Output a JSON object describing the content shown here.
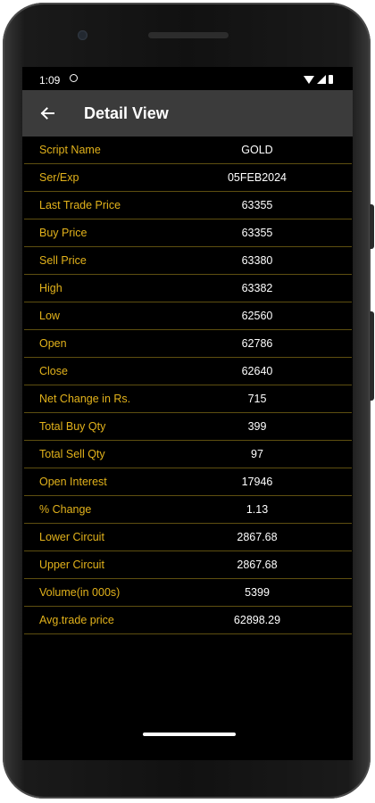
{
  "status": {
    "time": "1:09"
  },
  "toolbar": {
    "title": "Detail View"
  },
  "details": [
    {
      "label": "Script Name",
      "value": "GOLD"
    },
    {
      "label": "Ser/Exp",
      "value": "05FEB2024"
    },
    {
      "label": "Last Trade Price",
      "value": "63355"
    },
    {
      "label": "Buy Price",
      "value": "63355"
    },
    {
      "label": "Sell Price",
      "value": "63380"
    },
    {
      "label": "High",
      "value": "63382"
    },
    {
      "label": "Low",
      "value": "62560"
    },
    {
      "label": "Open",
      "value": "62786"
    },
    {
      "label": "Close",
      "value": "62640"
    },
    {
      "label": "Net Change in Rs.",
      "value": "715"
    },
    {
      "label": "Total Buy Qty",
      "value": "399"
    },
    {
      "label": "Total Sell Qty",
      "value": "97"
    },
    {
      "label": "Open Interest",
      "value": "17946"
    },
    {
      "label": "% Change",
      "value": "1.13"
    },
    {
      "label": "Lower Circuit",
      "value": "2867.68"
    },
    {
      "label": "Upper Circuit",
      "value": "2867.68"
    },
    {
      "label": "Volume(in 000s)",
      "value": "5399"
    },
    {
      "label": "Avg.trade price",
      "value": "62898.29"
    }
  ],
  "colors": {
    "label": "#e2b21b",
    "value": "#ffffff",
    "toolbar": "#3b3b3b",
    "divider": "#5e4f10"
  }
}
